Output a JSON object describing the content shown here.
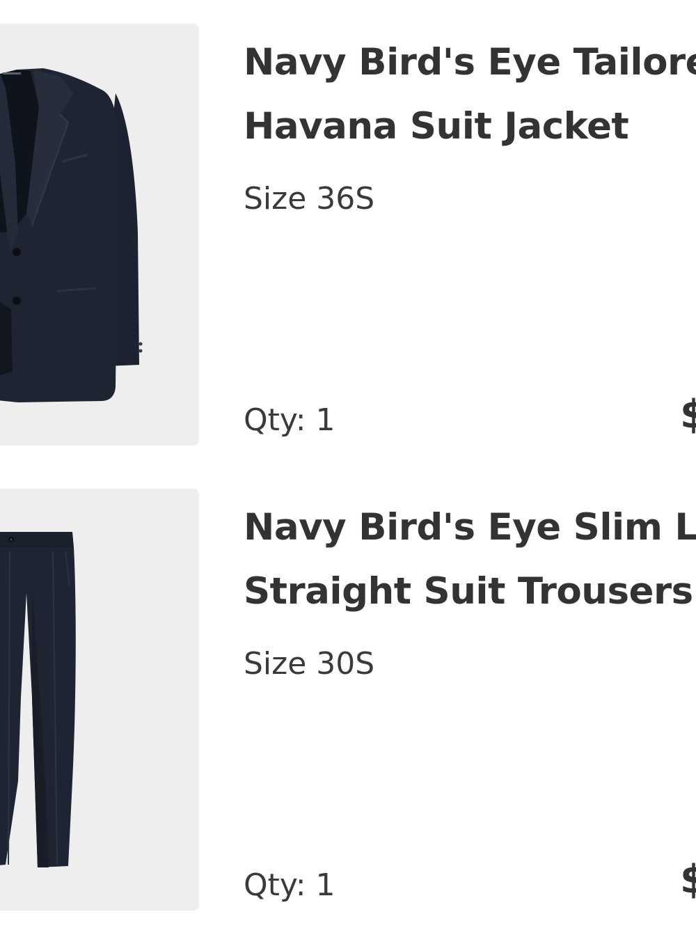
{
  "cart": {
    "items": [
      {
        "title_line1": "Navy Bird's Eye Tailore",
        "title_line2": "Havana Suit Jacket",
        "size": "Size 36S",
        "qty": "Qty: 1",
        "price": "$",
        "image": "navy-suit-jacket"
      },
      {
        "title_line1": "Navy Bird's Eye Slim Le",
        "title_line2": "Straight Suit Trousers",
        "size": "Size 30S",
        "qty": "Qty: 1",
        "price": "$",
        "image": "navy-suit-trousers"
      }
    ]
  },
  "colors": {
    "thumbnail_bg": "#eeeeee",
    "garment": "#1d2330",
    "text_primary": "#333333",
    "text_secondary": "#3a3a3a"
  }
}
